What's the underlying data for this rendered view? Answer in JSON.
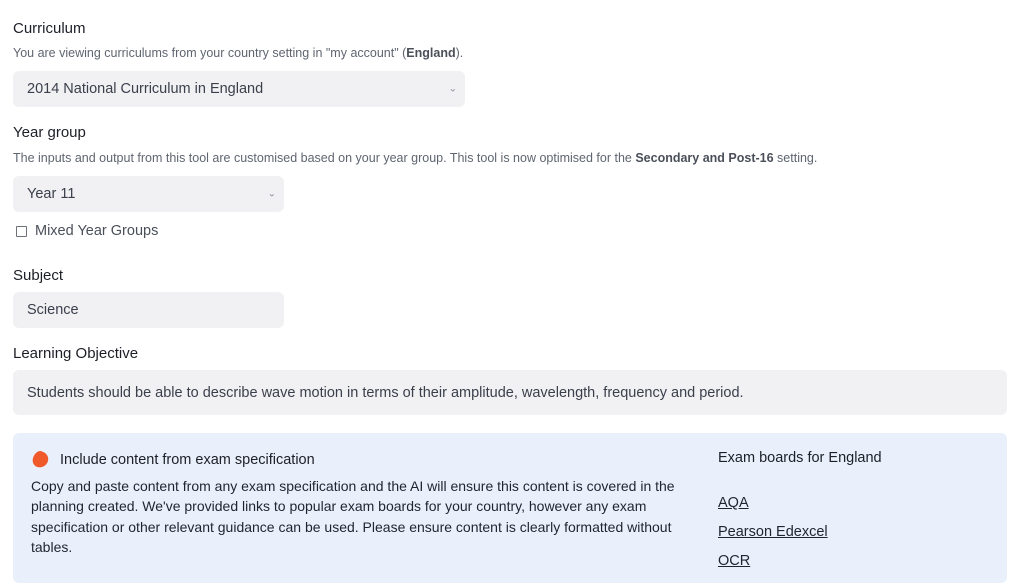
{
  "curriculum": {
    "label": "Curriculum",
    "help_prefix": "You are viewing curriculums from your country setting in \"my account\" (",
    "help_country": "England",
    "help_suffix": ").",
    "selected": "2014 National Curriculum in England"
  },
  "year_group": {
    "label": "Year group",
    "help_prefix": "The inputs and output from this tool are customised based on your year group. This tool is now optimised for the ",
    "help_setting": "Secondary and Post-16",
    "help_suffix": " setting.",
    "selected": "Year 11",
    "mixed_label": "Mixed Year Groups"
  },
  "subject": {
    "label": "Subject",
    "value": "Science"
  },
  "learning_objective": {
    "label": "Learning Objective",
    "value": "Students should be able to describe wave motion in terms of their amplitude, wavelength, frequency and period."
  },
  "exam_panel": {
    "title": "Include content from exam specification",
    "description": "Copy and paste content from any exam specification and the AI will ensure this content is covered in the planning created. We've provided links to popular exam boards for your country, however any exam specification or other relevant guidance can be used. Please ensure content is clearly formatted without tables.",
    "boards_title": "Exam boards for England",
    "boards": [
      "AQA",
      "Pearson Edexcel",
      "OCR"
    ],
    "accent_color": "#f05a2b",
    "background": "#e9f0fb"
  }
}
